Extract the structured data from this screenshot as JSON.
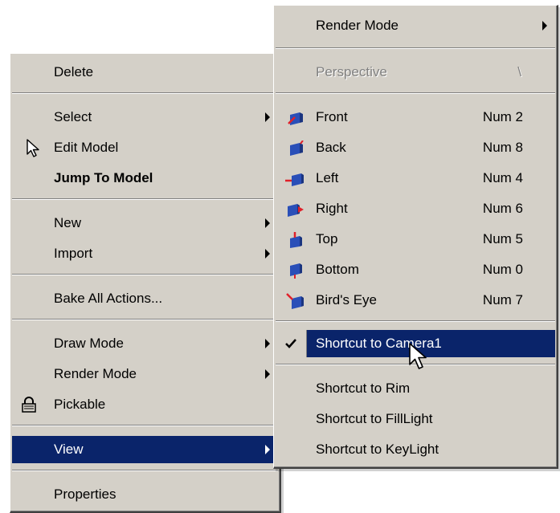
{
  "main_menu": {
    "items": [
      {
        "label": "Delete"
      },
      {
        "label": "Select",
        "submenu": true
      },
      {
        "label": "Edit Model",
        "icon": "arrow-cursor-icon"
      },
      {
        "label": "Jump To Model",
        "bold": true
      },
      {
        "label": "New",
        "submenu": true
      },
      {
        "label": "Import",
        "submenu": true
      },
      {
        "label": "Bake All Actions..."
      },
      {
        "label": "Draw Mode",
        "submenu": true
      },
      {
        "label": "Render Mode",
        "submenu": true
      },
      {
        "label": "Pickable",
        "icon": "padlock-icon"
      },
      {
        "label": "View",
        "submenu": true,
        "selected": true
      },
      {
        "label": "Properties"
      }
    ]
  },
  "view_menu": {
    "render_mode": "Render Mode",
    "perspective": {
      "label": "Perspective",
      "shortcut": "\\"
    },
    "cameras": [
      {
        "label": "Front",
        "shortcut": "Num 2",
        "icon": "cube-front-icon"
      },
      {
        "label": "Back",
        "shortcut": "Num 8",
        "icon": "cube-back-icon"
      },
      {
        "label": "Left",
        "shortcut": "Num 4",
        "icon": "cube-left-icon"
      },
      {
        "label": "Right",
        "shortcut": "Num 6",
        "icon": "cube-right-icon"
      },
      {
        "label": "Top",
        "shortcut": "Num 5",
        "icon": "cube-top-icon"
      },
      {
        "label": "Bottom",
        "shortcut": "Num 0",
        "icon": "cube-bottom-icon"
      },
      {
        "label": "Bird's Eye",
        "shortcut": "Num 7",
        "icon": "cube-birdseye-icon"
      }
    ],
    "camera_shortcut": {
      "label": "Shortcut to Camera1",
      "checked": true
    },
    "light_shortcuts": [
      {
        "label": "Shortcut to Rim"
      },
      {
        "label": "Shortcut to FillLight"
      },
      {
        "label": "Shortcut to KeyLight"
      }
    ]
  },
  "colors": {
    "menu_bg": "#d4d0c8",
    "selection": "#0a246a",
    "cube": "#2a4fb8",
    "marker": "#e0202a"
  }
}
